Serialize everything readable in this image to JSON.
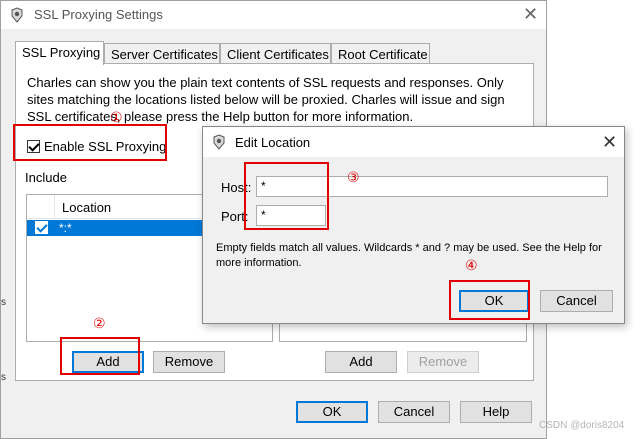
{
  "window": {
    "title": "SSL Proxying Settings",
    "close_glyph": "✕"
  },
  "tabs": [
    {
      "label": "SSL Proxying"
    },
    {
      "label": "Server Certificates"
    },
    {
      "label": "Client Certificates"
    },
    {
      "label": "Root Certificate"
    }
  ],
  "panel": {
    "description_line1": "Charles can show you the plain text contents of SSL requests and responses. Only",
    "description_line2": "sites matching the locations listed below will be proxied. Charles will issue and sign",
    "description_line3": "SSL certificates, please press the Help button for more information.",
    "enable_label": "Enable SSL Proxying",
    "enable_checked": true,
    "include_label": "Include",
    "table": {
      "column_header": "Location",
      "rows": [
        {
          "checked": true,
          "location": "*:*"
        }
      ]
    },
    "add_label": "Add",
    "remove_label": "Remove",
    "exclude_add_label": "Add",
    "exclude_remove_label": "Remove"
  },
  "footer": {
    "ok_label": "OK",
    "cancel_label": "Cancel",
    "help_label": "Help"
  },
  "dialog": {
    "title": "Edit Location",
    "close_glyph": "✕",
    "host_label": "Host:",
    "host_value": "*",
    "port_label": "Port:",
    "port_value": "*",
    "help_line1": "Empty fields match all values. Wildcards * and ? may be used. See the Help for",
    "help_line2": "more information.",
    "ok_label": "OK",
    "cancel_label": "Cancel"
  },
  "annotations": {
    "n1": "①",
    "n2": "②",
    "n3": "③",
    "n4": "④",
    "color": "#e00000"
  },
  "watermark": "CSDN @doris8204",
  "colors": {
    "selection": "#0078d7",
    "annotation_red": "#e00000"
  }
}
